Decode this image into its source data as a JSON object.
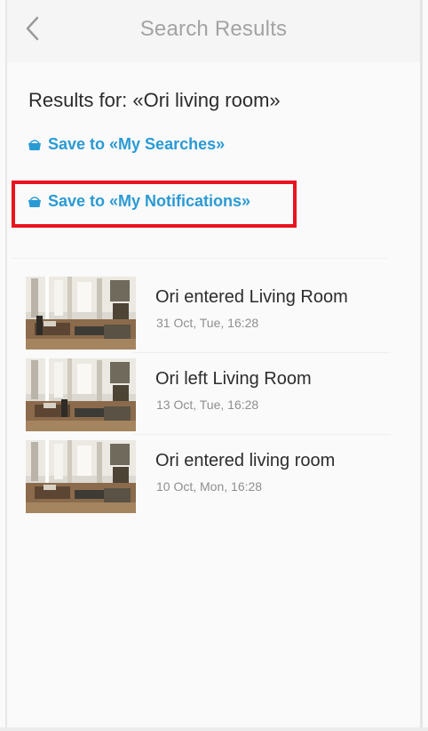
{
  "header": {
    "title": "Search Results",
    "back_icon": "chevron-left-icon"
  },
  "results_heading": "Results for: «Ori living room»",
  "actions": {
    "save_searches_label": "Save to «My Searches»",
    "save_notifications_label": "Save to «My Notifications»",
    "save_icon": "bucket-icon"
  },
  "colors": {
    "link": "#2a9ad4",
    "highlight": "#e8141f"
  },
  "results": [
    {
      "title": "Ori entered Living Room",
      "date": "31 Oct, Tue, 16:28"
    },
    {
      "title": "Ori left Living Room",
      "date": "13 Oct, Tue, 16:28"
    },
    {
      "title": "Ori entered living room",
      "date": "10 Oct, Mon, 16:28"
    }
  ]
}
